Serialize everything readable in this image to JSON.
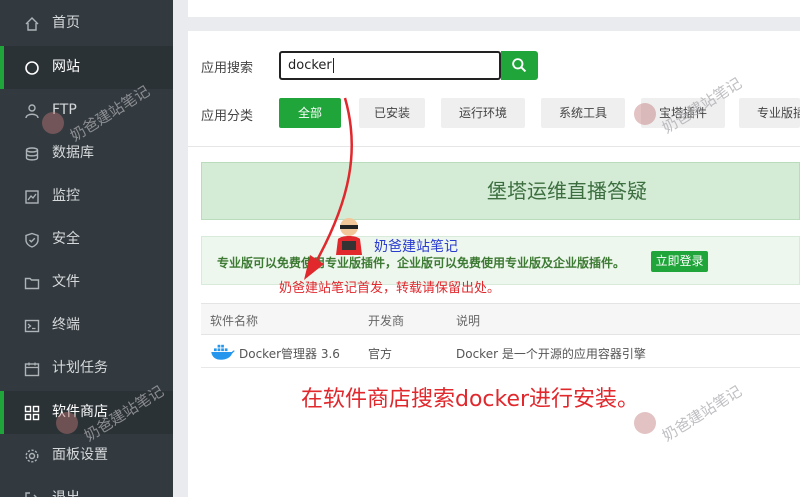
{
  "sidebar": {
    "items": [
      {
        "label": "首页",
        "icon": "home-icon"
      },
      {
        "label": "网站",
        "icon": "globe-icon"
      },
      {
        "label": "FTP",
        "icon": "ftp-user-icon"
      },
      {
        "label": "数据库",
        "icon": "database-icon"
      },
      {
        "label": "监控",
        "icon": "monitor-chart-icon"
      },
      {
        "label": "安全",
        "icon": "shield-icon"
      },
      {
        "label": "文件",
        "icon": "folder-icon"
      },
      {
        "label": "终端",
        "icon": "terminal-icon"
      },
      {
        "label": "计划任务",
        "icon": "calendar-icon"
      },
      {
        "label": "软件商店",
        "icon": "grid-apps-icon"
      },
      {
        "label": "面板设置",
        "icon": "gear-icon"
      },
      {
        "label": "退出",
        "icon": "logout-icon"
      }
    ]
  },
  "search": {
    "label": "应用搜索",
    "value": "docker",
    "button_icon": "search-icon"
  },
  "categories": {
    "label": "应用分类",
    "items": [
      "全部",
      "已安装",
      "运行环境",
      "系统工具",
      "宝塔插件",
      "专业版插"
    ]
  },
  "banner": {
    "text": "堡塔运维直播答疑"
  },
  "notice": {
    "text": "专业版可以免费使用专业版插件，企业版可以免费使用专业版及企业版插件。",
    "login_button": "立即登录"
  },
  "table": {
    "headers": [
      "软件名称",
      "开发商",
      "说明"
    ],
    "rows": [
      {
        "name": "Docker管理器 3.6",
        "developer": "官方",
        "description": "Docker 是一个开源的应用容器引擎",
        "icon": "docker-whale-icon"
      }
    ]
  },
  "annotations": {
    "watermark": "奶爸建站笔记",
    "first_post_note": "奶爸建站笔记首发，转载请保留出处。",
    "instruction": "在软件商店搜索docker进行安装。"
  },
  "colors": {
    "accent": "#20a53a",
    "sidebar_bg": "#323a3f",
    "annotation_red": "#e0282d",
    "watermark_blue": "#2a3bd0"
  }
}
